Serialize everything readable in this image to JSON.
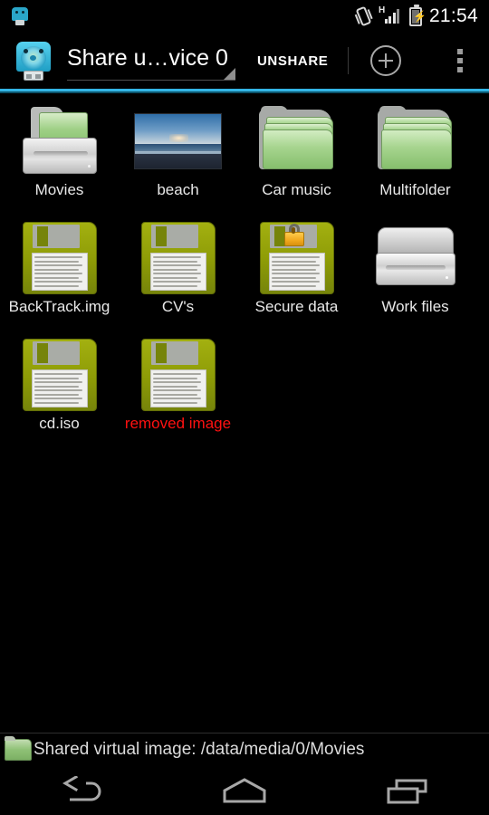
{
  "status_bar": {
    "notification_icon": "app-notification-icon",
    "vibrate_icon": "vibrate-icon",
    "network_type": "H",
    "signal_icon": "signal-bars-icon",
    "battery_icon": "battery-charging-icon",
    "clock": "21:54"
  },
  "action_bar": {
    "app_icon": "app-logo-icon",
    "title": "Share u…vice 0",
    "spinner_caret": "dropdown-caret-icon",
    "unshare_label": "UNSHARE",
    "add_icon": "plus-circle-icon",
    "overflow_icon": "overflow-menu-icon",
    "accent_color": "#33b5e5"
  },
  "grid": {
    "items": [
      {
        "label": "Movies",
        "icon": "drive-with-folder-icon",
        "state": "normal"
      },
      {
        "label": "beach",
        "icon": "photo-thumbnail-icon",
        "state": "normal"
      },
      {
        "label": "Car music",
        "icon": "folder-stack-icon",
        "state": "normal"
      },
      {
        "label": "Multifolder",
        "icon": "folder-stack-icon",
        "state": "normal"
      },
      {
        "label": "BackTrack.img",
        "icon": "floppy-disk-icon",
        "state": "normal"
      },
      {
        "label": "CV's",
        "icon": "floppy-disk-icon",
        "state": "normal"
      },
      {
        "label": "Secure data",
        "icon": "floppy-disk-locked-icon",
        "state": "normal"
      },
      {
        "label": "Work files",
        "icon": "drive-icon",
        "state": "normal"
      },
      {
        "label": "cd.iso",
        "icon": "floppy-disk-icon",
        "state": "normal"
      },
      {
        "label": "removed image",
        "icon": "floppy-disk-icon",
        "state": "removed"
      }
    ],
    "removed_color": "#ff1111"
  },
  "bottom_status": {
    "folder_icon": "green-folder-icon",
    "text": "Shared virtual image: /data/media/0/Movies"
  },
  "nav_bar": {
    "back": "back-icon",
    "home": "home-icon",
    "recents": "recents-icon"
  }
}
